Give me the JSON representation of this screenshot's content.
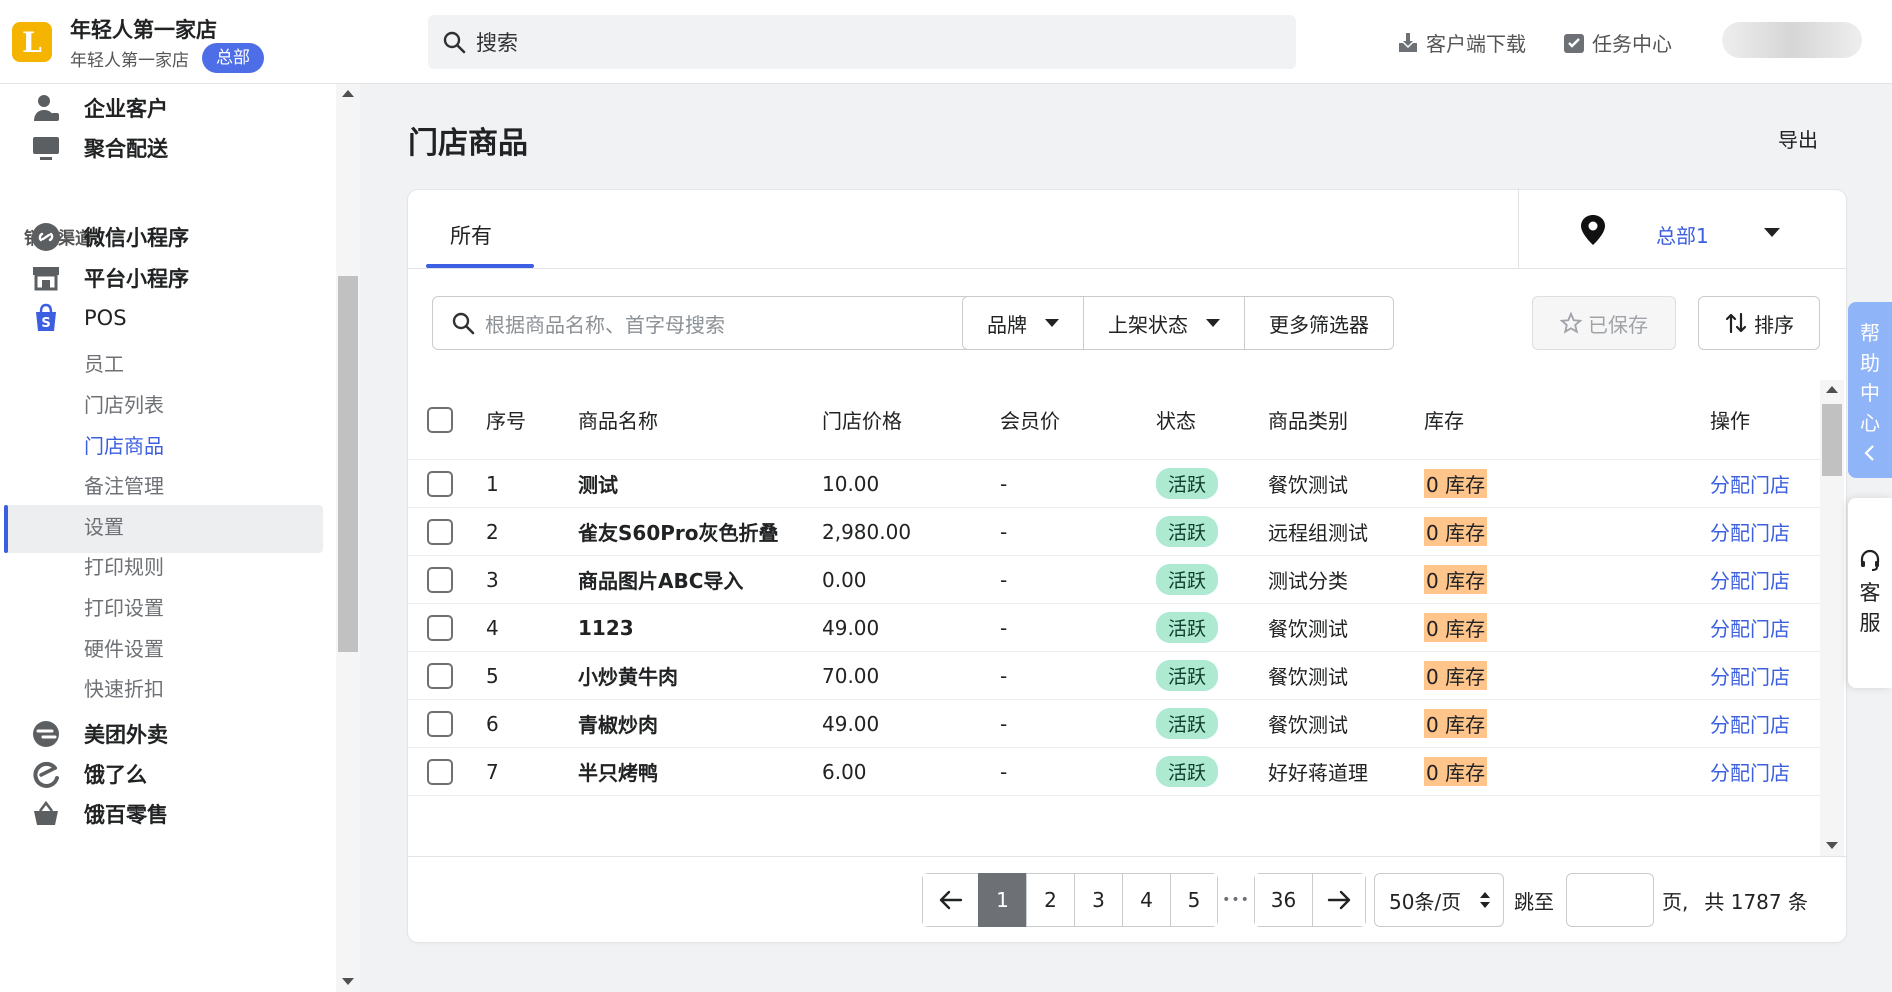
{
  "header": {
    "store_name": "年轻人第一家店",
    "store_sub": "年轻人第一家店",
    "hq_badge": "总部",
    "search_placeholder": "搜索",
    "download_label": "客户端下载",
    "task_label": "任务中心"
  },
  "sidebar": {
    "top_items": [
      {
        "label": "企业客户",
        "icon": "person-icon"
      },
      {
        "label": "聚合配送",
        "icon": "monitor-icon"
      }
    ],
    "section_label": "销售渠道",
    "channels": [
      {
        "label": "微信小程序",
        "icon": "link-circle-icon"
      },
      {
        "label": "平台小程序",
        "icon": "storefront-icon"
      },
      {
        "label": "POS",
        "icon": "shopping-bag-icon"
      }
    ],
    "pos_subitems": [
      "员工",
      "门店列表",
      "门店商品",
      "备注管理",
      "设置",
      "打印规则",
      "打印设置",
      "硬件设置",
      "快速折扣"
    ],
    "active_subitem": "门店商品",
    "bottom_items": [
      {
        "label": "美团外卖",
        "icon": "meituan-icon"
      },
      {
        "label": "饿了么",
        "icon": "eleme-icon"
      },
      {
        "label": "饿百零售",
        "icon": "basket-icon"
      }
    ]
  },
  "page": {
    "title": "门店商品",
    "export_label": "导出"
  },
  "tabs": {
    "all_label": "所有",
    "location_name": "总部1"
  },
  "filters": {
    "search_placeholder": "根据商品名称、首字母搜索",
    "brand_label": "品牌",
    "status_label": "上架状态",
    "more_label": "更多筛选器",
    "saved_label": "已保存",
    "sort_label": "排序"
  },
  "table": {
    "columns": [
      "序号",
      "商品名称",
      "门店价格",
      "会员价",
      "状态",
      "商品类别",
      "库存",
      "操作"
    ],
    "rows": [
      {
        "no": "1",
        "name": "测试",
        "price": "10.00",
        "member": "-",
        "status": "活跃",
        "category": "餐饮测试",
        "stock": "0 库存",
        "action": "分配门店"
      },
      {
        "no": "2",
        "name": "雀友S60Pro灰色折叠",
        "price": "2,980.00",
        "member": "-",
        "status": "活跃",
        "category": "远程组测试",
        "stock": "0 库存",
        "action": "分配门店"
      },
      {
        "no": "3",
        "name": "商品图片ABC导入",
        "price": "0.00",
        "member": "-",
        "status": "活跃",
        "category": "测试分类",
        "stock": "0 库存",
        "action": "分配门店"
      },
      {
        "no": "4",
        "name": "1123",
        "price": "49.00",
        "member": "-",
        "status": "活跃",
        "category": "餐饮测试",
        "stock": "0 库存",
        "action": "分配门店"
      },
      {
        "no": "5",
        "name": "小炒黄牛肉",
        "price": "70.00",
        "member": "-",
        "status": "活跃",
        "category": "餐饮测试",
        "stock": "0 库存",
        "action": "分配门店"
      },
      {
        "no": "6",
        "name": "青椒炒肉",
        "price": "49.00",
        "member": "-",
        "status": "活跃",
        "category": "餐饮测试",
        "stock": "0 库存",
        "action": "分配门店"
      },
      {
        "no": "7",
        "name": "半只烤鸭",
        "price": "6.00",
        "member": "-",
        "status": "活跃",
        "category": "好好蒋道理",
        "stock": "0 库存",
        "action": "分配门店"
      }
    ]
  },
  "pagination": {
    "pages": [
      "1",
      "2",
      "3",
      "4",
      "5"
    ],
    "current": "1",
    "ellipsis": "•••",
    "last_page": "36",
    "per_page": "50条/页",
    "jump_label": "跳至",
    "page_suffix": "页,",
    "total": "共 1787 条"
  },
  "widgets": {
    "help": [
      "帮",
      "助",
      "中",
      "心"
    ],
    "cs": [
      "客",
      "服"
    ]
  },
  "colors": {
    "accent": "#3b5fe0",
    "active_badge": "#aee9d1",
    "stock_highlight": "#ffc58b",
    "logo": "#f5b400"
  }
}
